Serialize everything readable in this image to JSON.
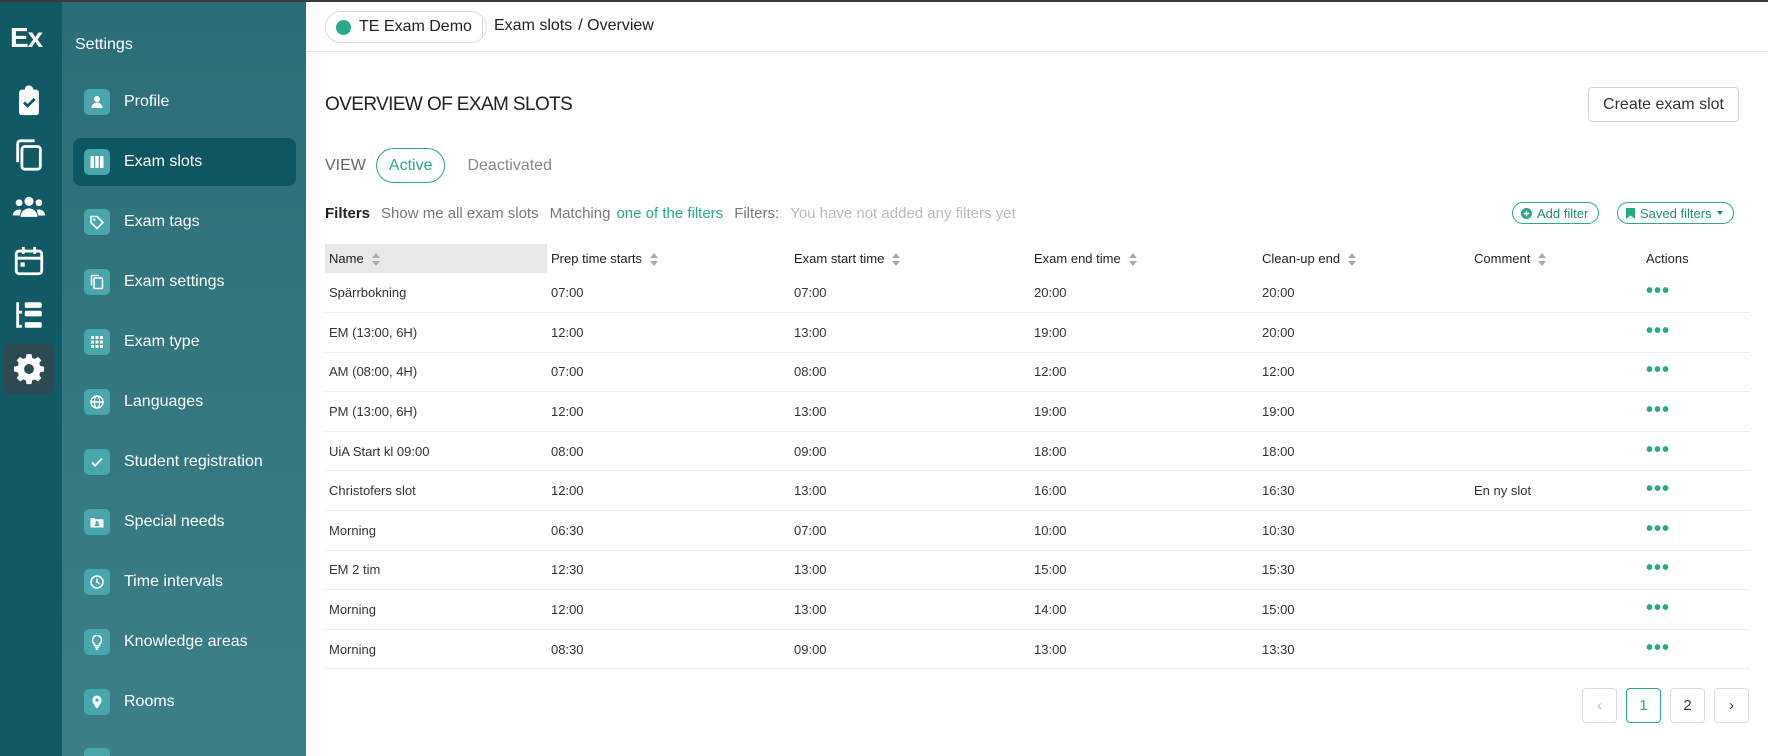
{
  "app": {
    "logo": "Ex"
  },
  "rail": {
    "items": [
      {
        "icon": "clipboard-check-icon"
      },
      {
        "icon": "copy-icon"
      },
      {
        "icon": "users-icon"
      },
      {
        "icon": "calendar-icon"
      },
      {
        "icon": "list-tree-icon"
      },
      {
        "icon": "gear-icon"
      }
    ]
  },
  "sidebar": {
    "title": "Settings",
    "items": [
      {
        "label": "Profile",
        "icon": "user-icon"
      },
      {
        "label": "Exam slots",
        "icon": "columns-icon"
      },
      {
        "label": "Exam tags",
        "icon": "tag-icon"
      },
      {
        "label": "Exam settings",
        "icon": "copy-icon"
      },
      {
        "label": "Exam type",
        "icon": "grid-icon"
      },
      {
        "label": "Languages",
        "icon": "globe-icon"
      },
      {
        "label": "Student registration",
        "icon": "check-icon"
      },
      {
        "label": "Special needs",
        "icon": "id-card-icon"
      },
      {
        "label": "Time intervals",
        "icon": "clock-icon"
      },
      {
        "label": "Knowledge areas",
        "icon": "lightbulb-icon"
      },
      {
        "label": "Rooms",
        "icon": "map-pin-icon"
      }
    ]
  },
  "header": {
    "org": "TE Exam Demo",
    "breadcrumb": [
      "Exam slots",
      "/ Overview"
    ]
  },
  "main": {
    "title": "OVERVIEW OF EXAM SLOTS",
    "create_label": "Create exam slot",
    "view": {
      "label": "VIEW",
      "tabs": [
        "Active",
        "Deactivated"
      ]
    },
    "filters": {
      "label": "Filters",
      "show_all": "Show me all exam slots",
      "matching": "Matching",
      "matching_value": "one of the filters",
      "filters_label": "Filters:",
      "empty": "You have not added any filters yet",
      "add_filter": "Add filter",
      "saved_filters": "Saved filters"
    },
    "table": {
      "columns": [
        "Name",
        "Prep time starts",
        "Exam start time",
        "Exam end time",
        "Clean-up end",
        "Comment",
        "Actions"
      ],
      "rows": [
        [
          "Spärrbokning",
          "07:00",
          "07:00",
          "20:00",
          "20:00",
          ""
        ],
        [
          "EM (13:00, 6H)",
          "12:00",
          "13:00",
          "19:00",
          "20:00",
          ""
        ],
        [
          "AM (08:00, 4H)",
          "07:00",
          "08:00",
          "12:00",
          "12:00",
          ""
        ],
        [
          "PM (13:00, 6H)",
          "12:00",
          "13:00",
          "19:00",
          "19:00",
          ""
        ],
        [
          "UiA Start kl 09:00",
          "08:00",
          "09:00",
          "18:00",
          "18:00",
          ""
        ],
        [
          "Christofers slot",
          "12:00",
          "13:00",
          "16:00",
          "16:30",
          "En ny slot"
        ],
        [
          "Morning",
          "06:30",
          "07:00",
          "10:00",
          "10:30",
          ""
        ],
        [
          "EM 2 tim",
          "12:30",
          "13:00",
          "15:00",
          "15:30",
          ""
        ],
        [
          "Morning",
          "12:00",
          "13:00",
          "14:00",
          "15:00",
          ""
        ],
        [
          "Morning",
          "08:30",
          "09:00",
          "13:00",
          "13:30",
          ""
        ]
      ],
      "action_glyph": "•••"
    },
    "pagination": {
      "prev": "‹",
      "pages": [
        "1",
        "2"
      ],
      "next": "›"
    }
  },
  "colors": {
    "accent": "#27a98a",
    "rail": "#0f5a64",
    "sidebar": "#2b6e77",
    "active_nav": "#0e5762"
  }
}
